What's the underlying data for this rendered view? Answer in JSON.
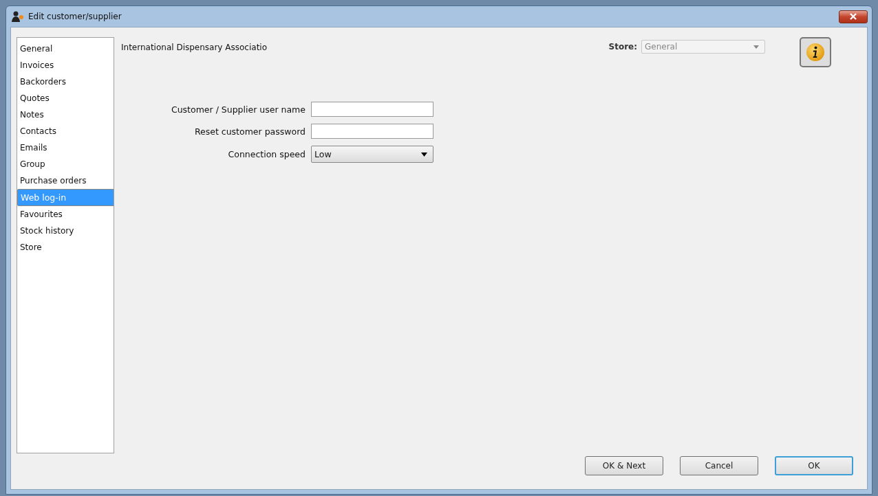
{
  "window": {
    "title": "Edit customer/supplier"
  },
  "sidebar": {
    "items": [
      {
        "label": "General",
        "selected": false
      },
      {
        "label": "Invoices",
        "selected": false
      },
      {
        "label": "Backorders",
        "selected": false
      },
      {
        "label": "Quotes",
        "selected": false
      },
      {
        "label": "Notes",
        "selected": false
      },
      {
        "label": "Contacts",
        "selected": false
      },
      {
        "label": "Emails",
        "selected": false
      },
      {
        "label": "Group",
        "selected": false
      },
      {
        "label": "Purchase orders",
        "selected": false
      },
      {
        "label": "Web log-in",
        "selected": true
      },
      {
        "label": "Favourites",
        "selected": false
      },
      {
        "label": "Stock history",
        "selected": false
      },
      {
        "label": "Store",
        "selected": false
      }
    ]
  },
  "name": "International Dispensary Associatio",
  "store": {
    "label": "Store:",
    "value": "General",
    "disabled": true
  },
  "form": [
    {
      "kind": "text",
      "label": "Customer / Supplier user name"
    },
    {
      "kind": "text",
      "label": "Reset customer password"
    },
    {
      "kind": "select",
      "label": "Connection speed",
      "value": "Low"
    }
  ],
  "buttons": [
    {
      "label": "OK & Next",
      "default": false
    },
    {
      "label": "Cancel",
      "default": false
    },
    {
      "label": "OK",
      "default": true
    }
  ]
}
